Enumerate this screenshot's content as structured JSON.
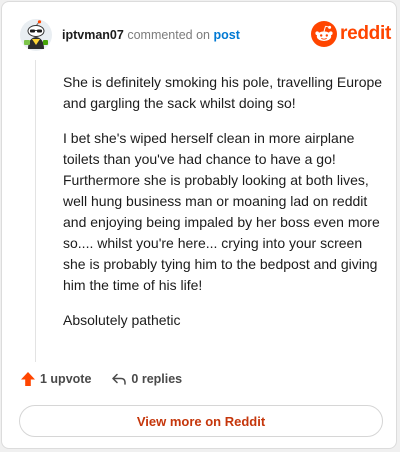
{
  "header": {
    "username": "iptvman07",
    "action_text": "commented on",
    "post_link": "post",
    "brand": "reddit"
  },
  "comment": {
    "paragraphs": [
      "She is definitely smoking his pole, travelling Europe and gargling the sack whilst doing so!",
      "I bet she's wiped herself clean in more airplane toilets than you've had chance to have a go! Furthermore she is probably looking at both lives, well hung business man or moaning lad on reddit and enjoying being impaled by her boss even more so.... whilst you're here... crying into your screen she is probably tying him to the bedpost and giving him the time of his life!",
      "Absolutely pathetic"
    ]
  },
  "actions": {
    "upvotes": "1 upvote",
    "replies": "0 replies"
  },
  "cta": {
    "label": "View more on Reddit"
  },
  "icons": {
    "avatar": "snoo-avatar-icon",
    "logo": "reddit-logo-icon",
    "upvote": "upvote-arrow-icon",
    "reply": "reply-arrow-icon"
  },
  "colors": {
    "brand": "#ff4500",
    "link": "#0079d3",
    "upvote": "#ff4500",
    "cta_text": "#c5360b"
  }
}
